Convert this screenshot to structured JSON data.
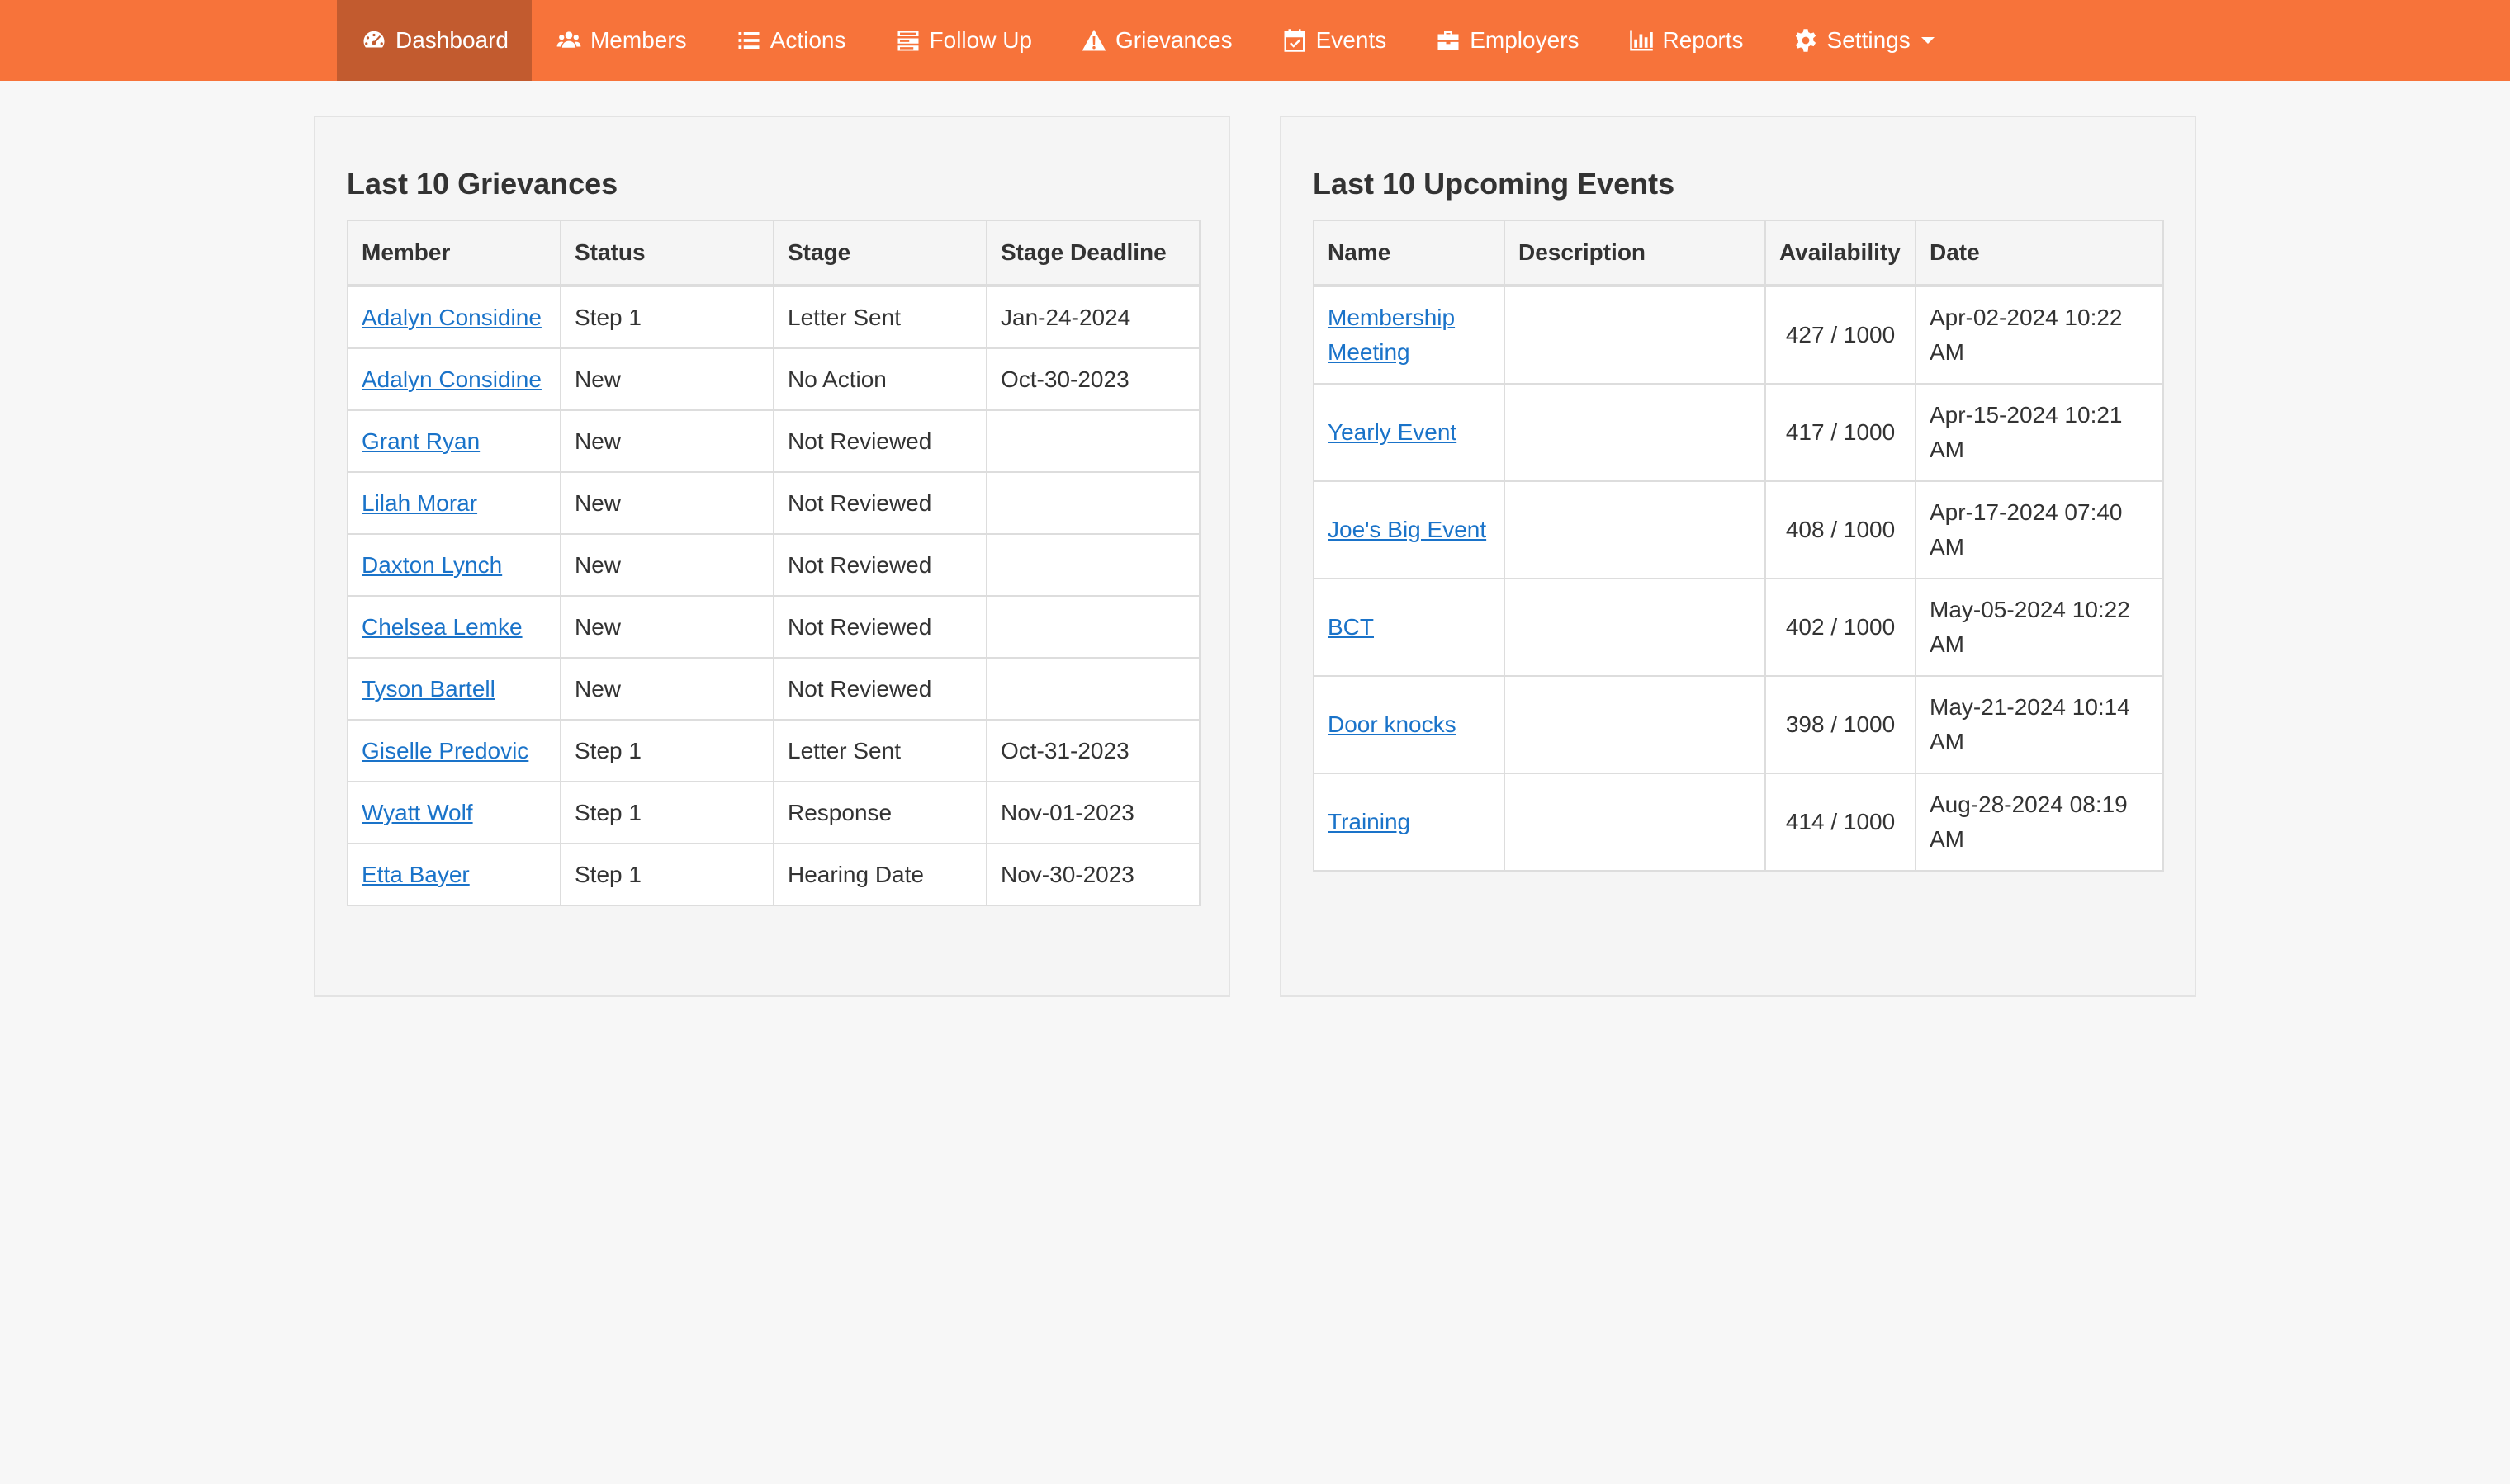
{
  "nav": {
    "items": [
      {
        "label": "Dashboard",
        "icon": "dashboard-icon",
        "active": true
      },
      {
        "label": "Members",
        "icon": "users-icon"
      },
      {
        "label": "Actions",
        "icon": "list-icon"
      },
      {
        "label": "Follow Up",
        "icon": "tasks-icon"
      },
      {
        "label": "Grievances",
        "icon": "warning-icon"
      },
      {
        "label": "Events",
        "icon": "calendar-check-icon"
      },
      {
        "label": "Employers",
        "icon": "briefcase-icon"
      },
      {
        "label": "Reports",
        "icon": "bar-chart-icon"
      },
      {
        "label": "Settings",
        "icon": "gear-icon",
        "dropdown": true
      }
    ]
  },
  "grievances": {
    "title": "Last 10 Grievances",
    "headers": [
      "Member",
      "Status",
      "Stage",
      "Stage Deadline"
    ],
    "rows": [
      {
        "member": "Adalyn Considine",
        "status": "Step 1",
        "stage": "Letter Sent",
        "deadline": "Jan-24-2024"
      },
      {
        "member": "Adalyn Considine",
        "status": "New",
        "stage": "No Action",
        "deadline": "Oct-30-2023"
      },
      {
        "member": "Grant Ryan",
        "status": "New",
        "stage": "Not Reviewed",
        "deadline": ""
      },
      {
        "member": "Lilah Morar",
        "status": "New",
        "stage": "Not Reviewed",
        "deadline": ""
      },
      {
        "member": "Daxton Lynch",
        "status": "New",
        "stage": "Not Reviewed",
        "deadline": ""
      },
      {
        "member": "Chelsea Lemke",
        "status": "New",
        "stage": "Not Reviewed",
        "deadline": ""
      },
      {
        "member": "Tyson Bartell",
        "status": "New",
        "stage": "Not Reviewed",
        "deadline": ""
      },
      {
        "member": "Giselle Predovic",
        "status": "Step 1",
        "stage": "Letter Sent",
        "deadline": "Oct-31-2023"
      },
      {
        "member": "Wyatt Wolf",
        "status": "Step 1",
        "stage": "Response",
        "deadline": "Nov-01-2023"
      },
      {
        "member": "Etta Bayer",
        "status": "Step 1",
        "stage": "Hearing Date",
        "deadline": "Nov-30-2023"
      }
    ]
  },
  "events": {
    "title": "Last 10 Upcoming Events",
    "headers": [
      "Name",
      "Description",
      "Availability",
      "Date"
    ],
    "rows": [
      {
        "name": "Membership Meeting",
        "description": "",
        "availability": "427 / 1000",
        "date": "Apr-02-2024 10:22 AM"
      },
      {
        "name": "Yearly Event",
        "description": "",
        "availability": "417 / 1000",
        "date": "Apr-15-2024 10:21 AM"
      },
      {
        "name": "Joe's Big Event",
        "description": "",
        "availability": "408 / 1000",
        "date": "Apr-17-2024 07:40 AM"
      },
      {
        "name": "BCT",
        "description": "",
        "availability": "402 / 1000",
        "date": "May-05-2024 10:22 AM"
      },
      {
        "name": "Door knocks",
        "description": "",
        "availability": "398 / 1000",
        "date": "May-21-2024 10:14 AM"
      },
      {
        "name": "Training",
        "description": "",
        "availability": "414 / 1000",
        "date": "Aug-28-2024 08:19 AM"
      }
    ]
  }
}
